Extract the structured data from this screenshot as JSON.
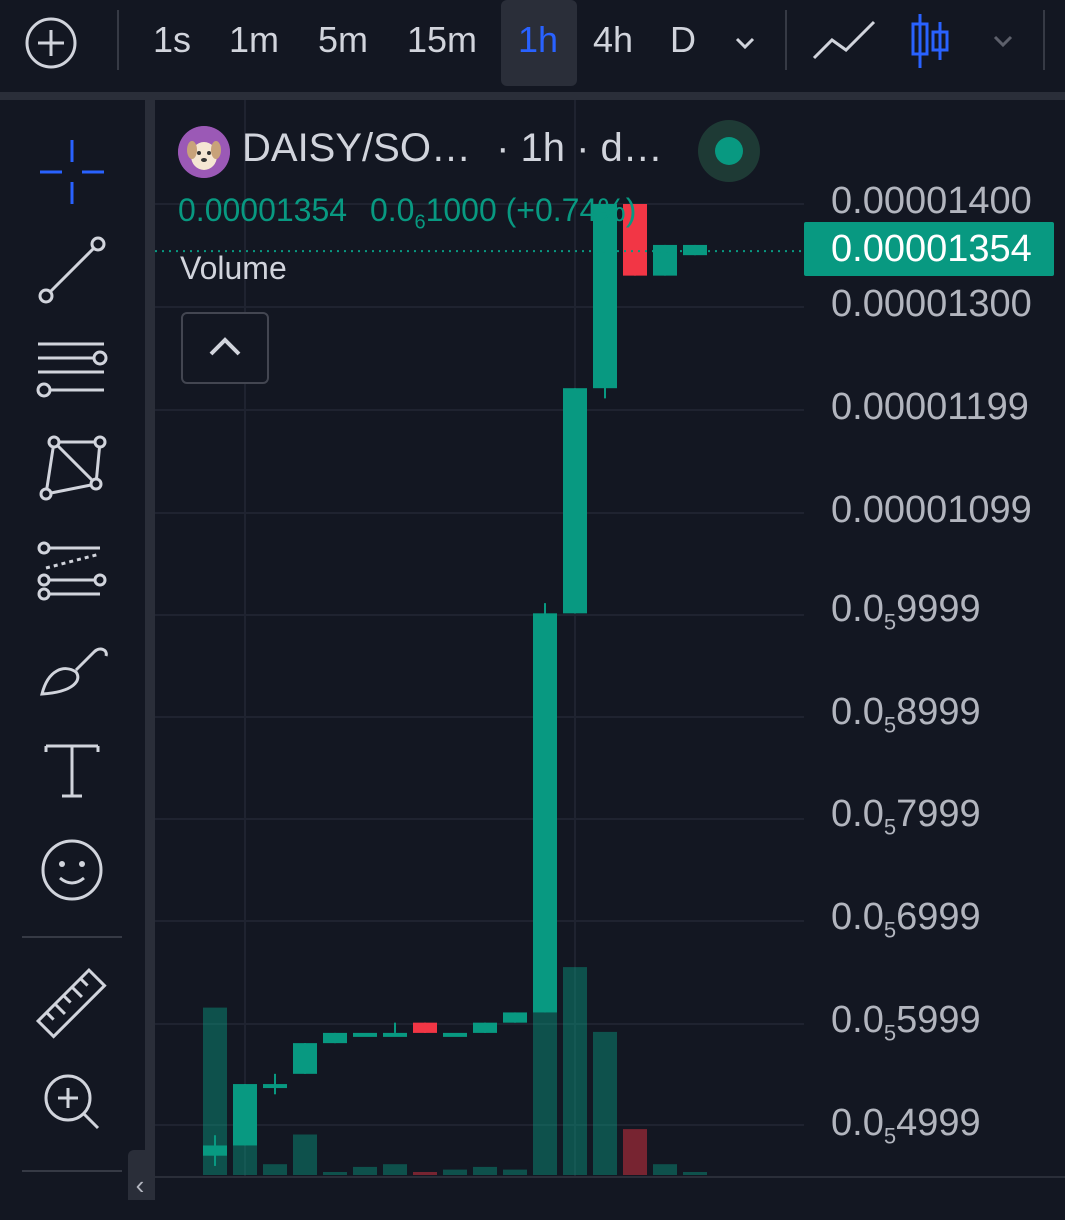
{
  "toolbar": {
    "timeframes": [
      "1s",
      "1m",
      "5m",
      "15m",
      "1h",
      "4h",
      "D"
    ],
    "active_timeframe": "1h"
  },
  "legend": {
    "symbol": "DAISY/SO…",
    "meta": "· 1h · d…",
    "price": "0.00001354",
    "change_prefix": "0.0",
    "change_sub": "6",
    "change_rest": "1000 (+0.74%)",
    "volume_label": "Volume"
  },
  "price_axis": {
    "labels": [
      {
        "text": "0.00001400"
      },
      {
        "text": "0.00001300"
      },
      {
        "text": "0.00001199"
      },
      {
        "text": "0.00001099"
      },
      {
        "pre": "0.0",
        "sub": "5",
        "post": "9999"
      },
      {
        "pre": "0.0",
        "sub": "5",
        "post": "8999"
      },
      {
        "pre": "0.0",
        "sub": "5",
        "post": "7999"
      },
      {
        "pre": "0.0",
        "sub": "5",
        "post": "6999"
      },
      {
        "pre": "0.0",
        "sub": "5",
        "post": "5999"
      },
      {
        "pre": "0.0",
        "sub": "5",
        "post": "4999"
      }
    ],
    "current_price": "0.00001354"
  },
  "colors": {
    "up": "#089981",
    "down": "#f23645",
    "accent": "#2962ff",
    "background": "#131722"
  },
  "bottom_tab_glyph": "‹",
  "chart_data": {
    "type": "candlestick",
    "ylim": [
      4.5e-06,
      1.42e-05
    ],
    "candles": [
      {
        "o": 4.7e-06,
        "h": 4.9e-06,
        "c": 4.8e-06,
        "l": 4.6e-06,
        "v": 0.62
      },
      {
        "o": 4.8e-06,
        "h": 5.4e-06,
        "c": 5.4e-06,
        "l": 4.8e-06,
        "v": 0.32
      },
      {
        "o": 5.4e-06,
        "h": 5.5e-06,
        "c": 5.4e-06,
        "l": 5.3e-06,
        "v": 0.04
      },
      {
        "o": 5.5e-06,
        "h": 5.8e-06,
        "c": 5.8e-06,
        "l": 5.5e-06,
        "v": 0.15
      },
      {
        "o": 5.8e-06,
        "h": 5.9e-06,
        "c": 5.9e-06,
        "l": 5.8e-06,
        "v": 0.01
      },
      {
        "o": 5.9e-06,
        "h": 5.9e-06,
        "c": 5.9e-06,
        "l": 5.9e-06,
        "v": 0.03
      },
      {
        "o": 5.9e-06,
        "h": 6e-06,
        "c": 5.9e-06,
        "l": 5.9e-06,
        "v": 0.04
      },
      {
        "o": 6e-06,
        "h": 6e-06,
        "c": 5.9e-06,
        "l": 5.9e-06,
        "v": 0.01
      },
      {
        "o": 5.9e-06,
        "h": 5.9e-06,
        "c": 5.9e-06,
        "l": 5.9e-06,
        "v": 0.02
      },
      {
        "o": 5.9e-06,
        "h": 6e-06,
        "c": 6e-06,
        "l": 5.9e-06,
        "v": 0.03
      },
      {
        "o": 6e-06,
        "h": 6.1e-06,
        "c": 6.1e-06,
        "l": 6e-06,
        "v": 0.02
      },
      {
        "o": 6.1e-06,
        "h": 1.01e-05,
        "c": 1e-05,
        "l": 6.1e-06,
        "v": 1.0
      },
      {
        "o": 1e-05,
        "h": 1.22e-05,
        "c": 1.22e-05,
        "l": 1e-05,
        "v": 0.77
      },
      {
        "o": 1.22e-05,
        "h": 1.4e-05,
        "c": 1.4e-05,
        "l": 1.21e-05,
        "v": 0.53
      },
      {
        "o": 1.4e-05,
        "h": 1.4e-05,
        "c": 1.33e-05,
        "l": 1.33e-05,
        "v": 0.17
      },
      {
        "o": 1.33e-05,
        "h": 1.36e-05,
        "c": 1.36e-05,
        "l": 1.33e-05,
        "v": 0.04
      },
      {
        "o": 1.35e-05,
        "h": 1.36e-05,
        "c": 1.36e-05,
        "l": 1.35e-05,
        "v": 0.01
      }
    ]
  }
}
